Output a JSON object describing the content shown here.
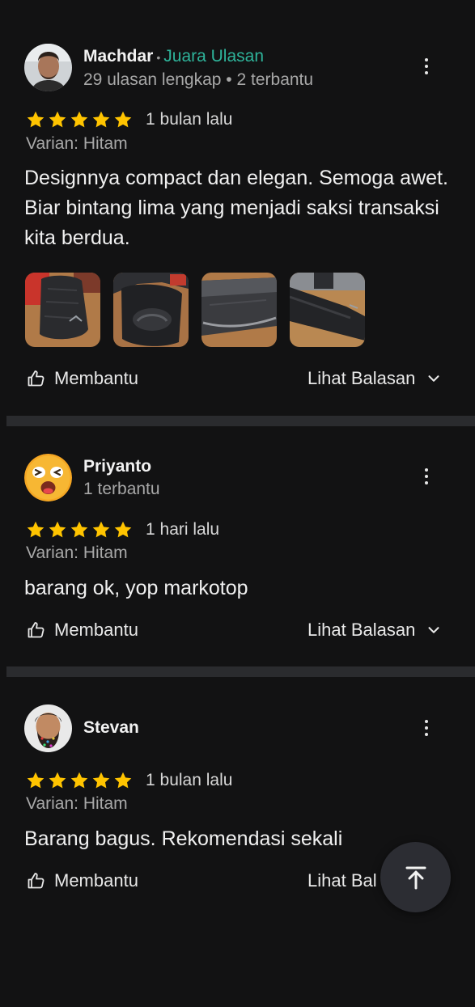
{
  "reviews": [
    {
      "name": "Machdar",
      "badge": "Juara Ulasan",
      "stats": "29 ulasan lengkap • 2 terbantu",
      "rating": 5,
      "time": "1 bulan lalu",
      "variant": "Varian: Hitam",
      "text": "Designnya compact dan elegan. Semoga awet. Biar bintang lima yang menjadi saksi transaksi kita berdua.",
      "photos": [
        "bag-photo-1",
        "bag-photo-2",
        "bag-photo-3",
        "bag-photo-4"
      ],
      "helpful_label": "Membantu",
      "reply_label": "Lihat Balasan"
    },
    {
      "name": "Priyanto",
      "stats": "1 terbantu",
      "rating": 5,
      "time": "1 hari lalu",
      "variant": "Varian: Hitam",
      "text": "barang ok, yop markotop",
      "helpful_label": "Membantu",
      "reply_label": "Lihat Balasan"
    },
    {
      "name": "Stevan",
      "rating": 5,
      "time": "1 bulan lalu",
      "variant": "Varian: Hitam",
      "text": "Barang bagus. Rekomendasi sekali",
      "helpful_label": "Membantu",
      "reply_label": "Lihat Bal"
    }
  ],
  "colors": {
    "background": "#121213",
    "badge": "#2eb39a",
    "star": "#ffc400",
    "divider": "#2a2b2e"
  },
  "icons": [
    "thumbs-up-icon",
    "chevron-down-icon",
    "more-vertical-icon",
    "star-icon",
    "scroll-to-top-icon"
  ]
}
